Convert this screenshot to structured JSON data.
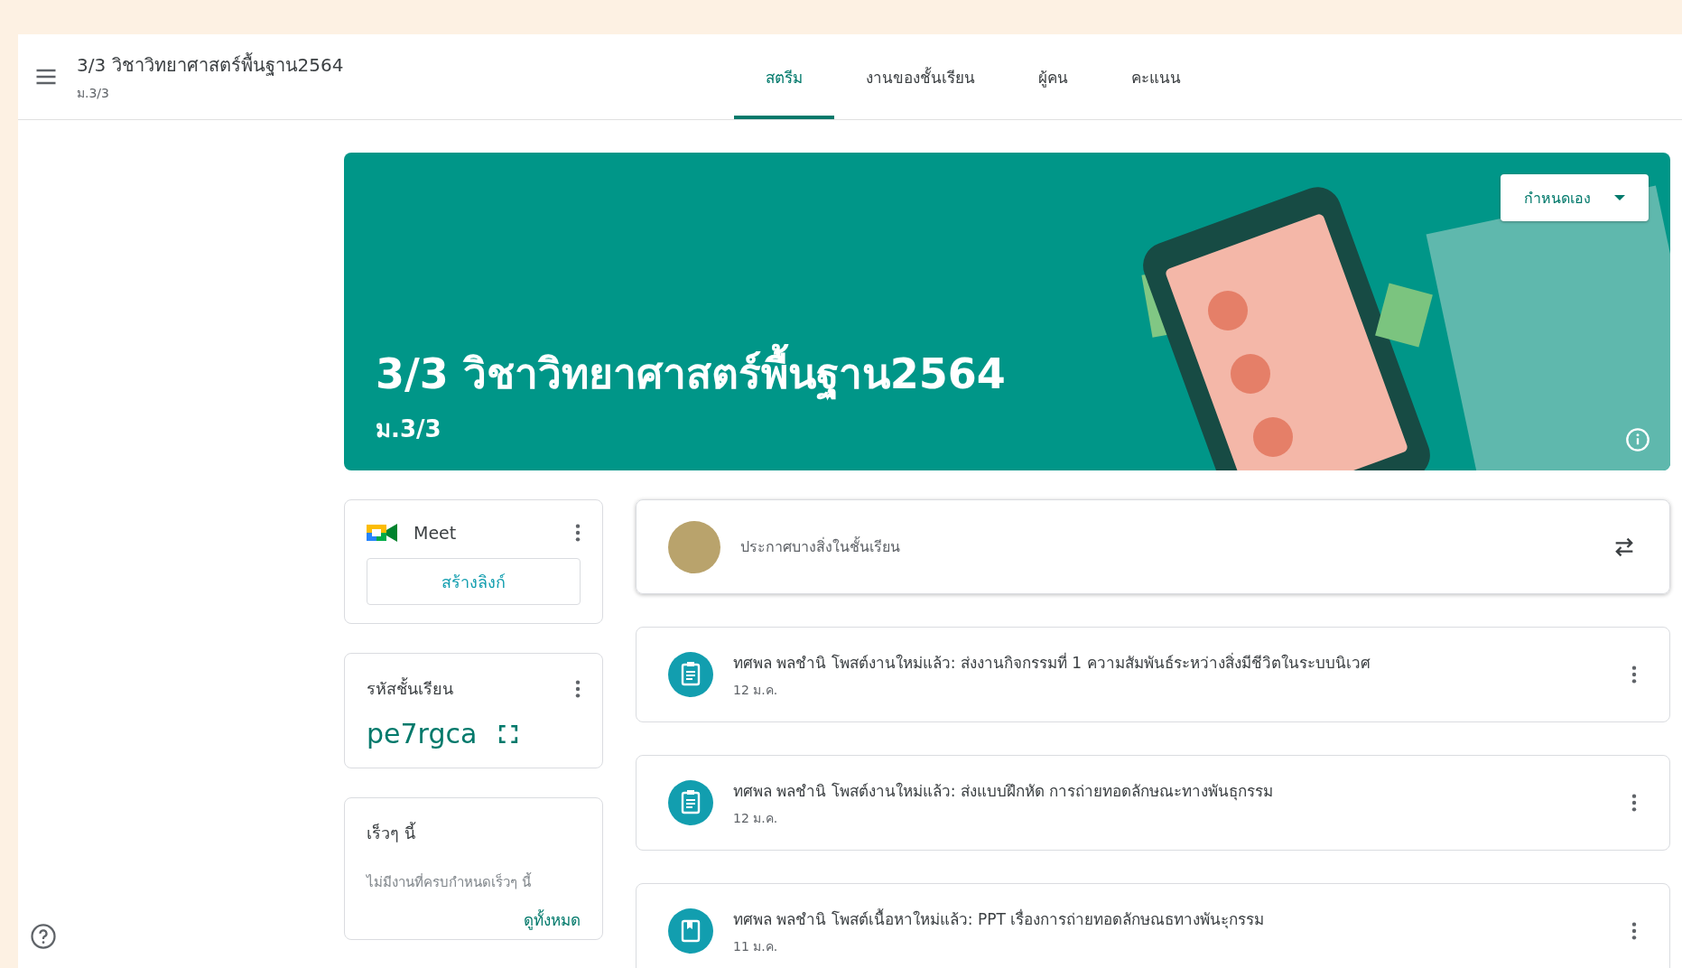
{
  "header": {
    "title": "3/3 วิชาวิทยาศาสตร์พื้นฐาน2564",
    "subtitle": "ม.3/3"
  },
  "tabs": [
    {
      "label": "สตรีม",
      "selected": true
    },
    {
      "label": "งานของชั้นเรียน",
      "selected": false
    },
    {
      "label": "ผู้คน",
      "selected": false
    },
    {
      "label": "คะแนน",
      "selected": false
    }
  ],
  "banner": {
    "title": "3/3 วิชาวิทยาศาสตร์พื้นฐาน2564",
    "subtitle": "ม.3/3",
    "customize_button": "กำหนดเอง"
  },
  "meet": {
    "title": "Meet",
    "button": "สร้างลิงก์"
  },
  "class_code": {
    "label": "รหัสชั้นเรียน",
    "code": "pe7rgca"
  },
  "upcoming": {
    "title": "เร็วๆ นี้",
    "message": "ไม่มีงานที่ครบกำหนดเร็วๆ นี้",
    "link": "ดูทั้งหมด"
  },
  "composer": {
    "placeholder": "ประกาศบางสิ่งในชั้นเรียน"
  },
  "posts": [
    {
      "kind": "assignment",
      "text": "ทศพล พลชำนิ โพสต์งานใหม่แล้ว: ส่งงานกิจกรรมที่ 1 ความสัมพันธ์ระหว่างสิ่งมีชีวิตในระบบนิเวศ",
      "date": "12 ม.ค."
    },
    {
      "kind": "assignment",
      "text": "ทศพล พลชำนิ โพสต์งานใหม่แล้ว: ส่งแบบฝึกหัด การถ่ายทอดลักษณะทางพันธุกรรม",
      "date": "12 ม.ค."
    },
    {
      "kind": "material",
      "text": "ทศพล พลชำนิ โพสต์เนื้อหาใหม่แล้ว: PPT เรื่องการถ่ายทอดลักษณธทางพันะุกรรม",
      "date": "11 ม.ค."
    }
  ]
}
